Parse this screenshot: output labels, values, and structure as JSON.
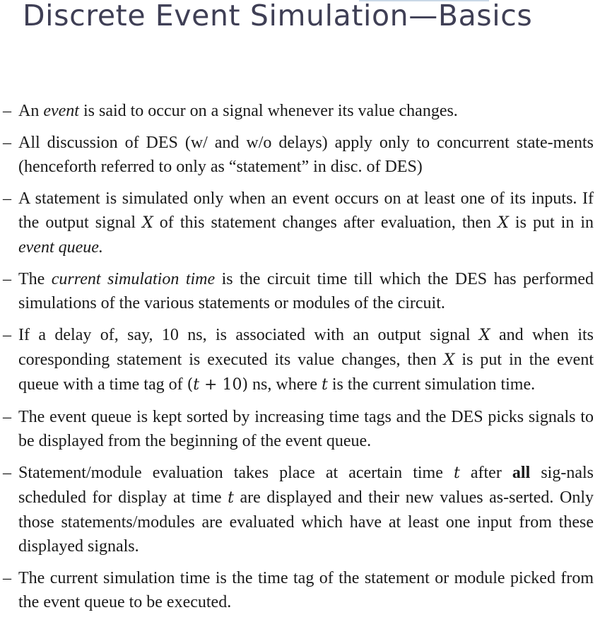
{
  "slide": {
    "title": "Discrete Event Simulation—Basics",
    "bullet_marker": "–",
    "bullets": [
      {
        "parts": [
          "An ",
          "event",
          " is said to occur on a signal whenever its value changes."
        ]
      },
      {
        "parts": [
          "All discussion of DES (w/ and w/o delays) apply only to concurrent state-­ments (henceforth referred to only as “statement” in disc. of DES)"
        ]
      },
      {
        "parts": [
          "A statement is simulated only when an event occurs on at least one of its inputs.  If the output signal ",
          "X",
          " of this statement changes after evaluation, then ",
          "X",
          " is put in in ",
          "event queue."
        ]
      },
      {
        "parts": [
          "The ",
          "current simulation time",
          " is the circuit time till which the DES has performed simulations of the various statements or modules of the circuit."
        ]
      },
      {
        "parts": [
          "If a delay of, say, 10 ns, is associated with an output signal ",
          "X",
          " and when its coresponding statement is executed its value changes, then ",
          "X",
          " is put in the event queue with a time tag of ",
          "(",
          "t",
          " + 10)",
          " ns, where ",
          "t",
          " is the current simulation time."
        ]
      },
      {
        "parts": [
          "The event queue is kept sorted by increasing time tags and the DES picks signals to be displayed from the beginning of the event queue."
        ]
      },
      {
        "parts": [
          "Statement/module evaluation takes place at acertain time ",
          "t",
          " after ",
          "all",
          " sig-­nals scheduled for display at time ",
          "t",
          " are displayed and their new values as-­serted.  Only those statements/modules are evaluated which have at least one input from these displayed signals."
        ]
      },
      {
        "parts": [
          "The current simulation time is the time tag of the statement or module picked from the event queue to be executed."
        ]
      }
    ]
  }
}
